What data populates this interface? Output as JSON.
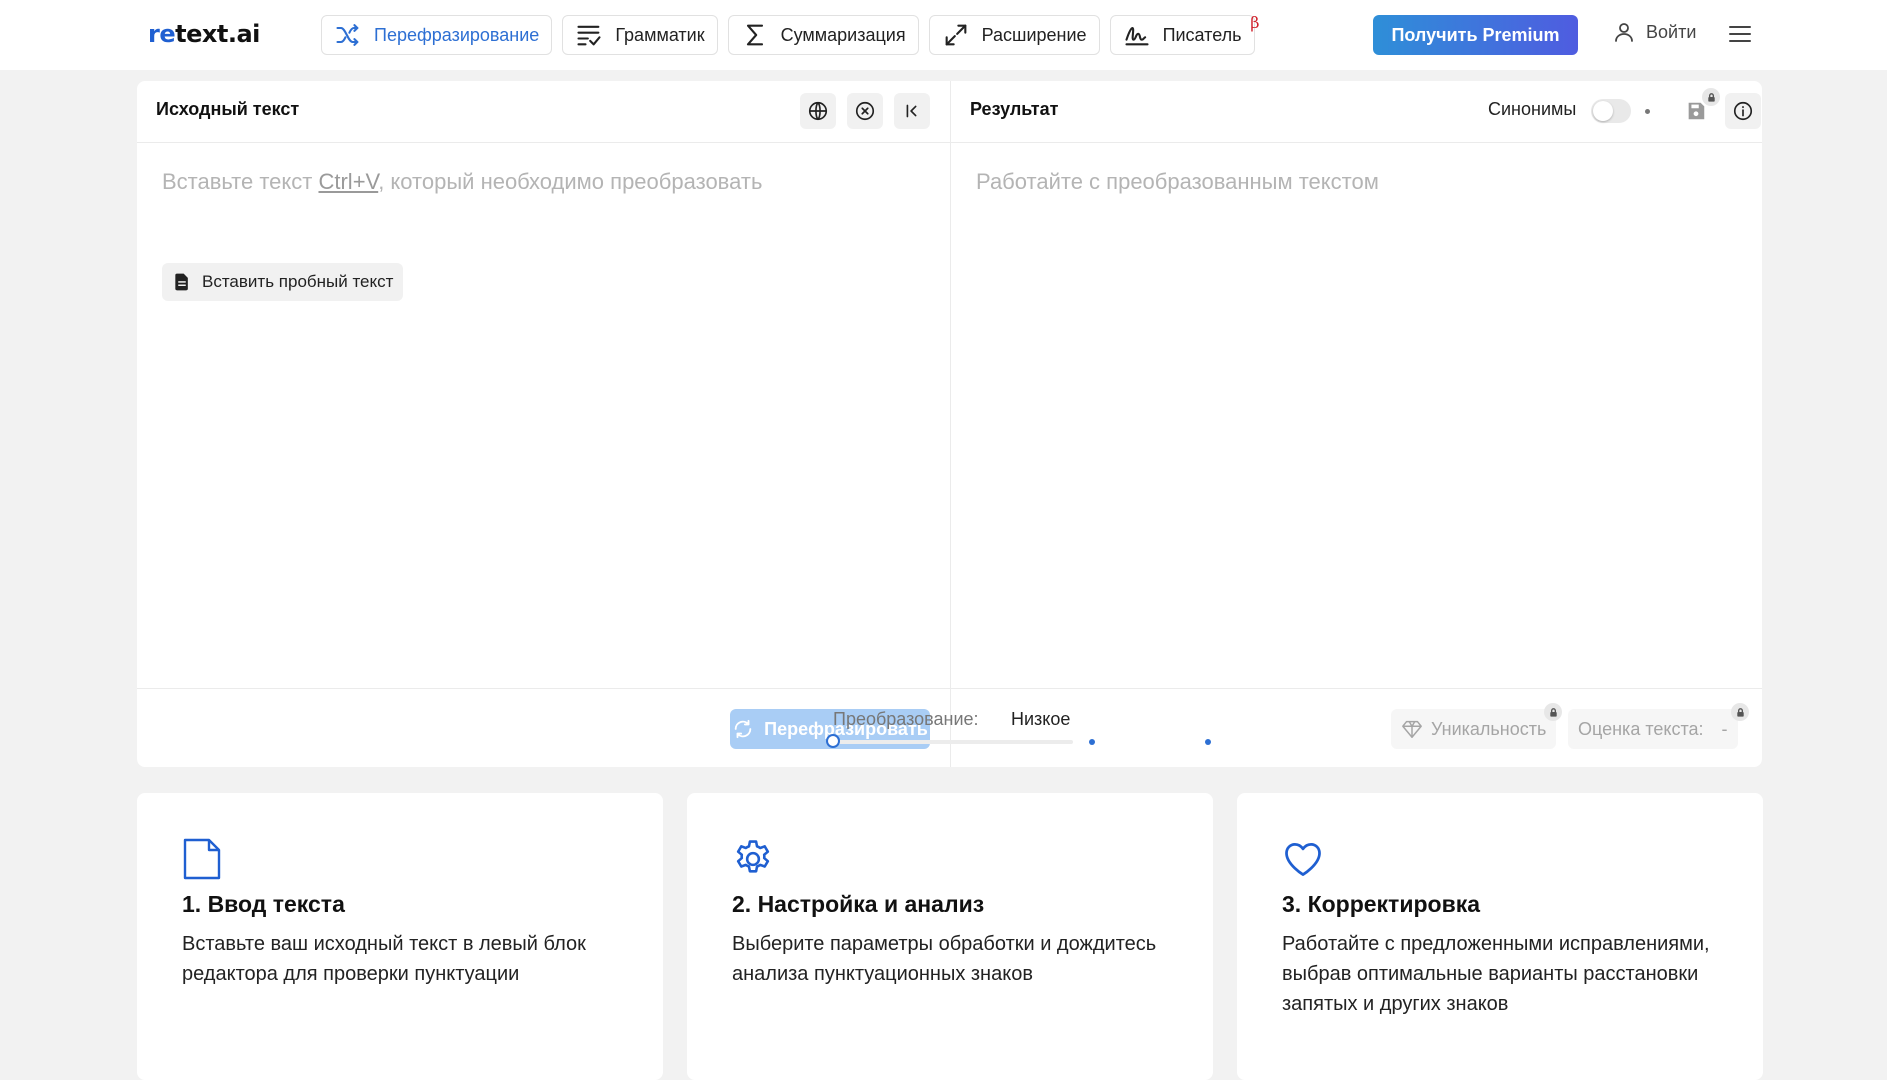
{
  "header": {
    "logo_prefix": "re",
    "logo_suffix": "text.ai",
    "nav": [
      {
        "label": "Перефразирование",
        "icon": "shuffle-icon",
        "active": true
      },
      {
        "label": "Грамматик",
        "icon": "grammar-check-icon",
        "active": false
      },
      {
        "label": "Суммаризация",
        "icon": "sigma-icon",
        "active": false
      },
      {
        "label": "Расширение",
        "icon": "expand-icon",
        "active": false
      },
      {
        "label": "Писатель",
        "icon": "signature-icon",
        "active": false,
        "badge": "β"
      }
    ],
    "premium_label": "Получить Premium",
    "login_label": "Войти"
  },
  "source": {
    "title": "Исходный текст",
    "placeholder_before": "Вставьте текст ",
    "placeholder_shortcut": "Ctrl+V",
    "placeholder_after": ", который необходимо преобразовать",
    "sample_label": "Вставить пробный текст",
    "action_label": "Перефразировать"
  },
  "result": {
    "title": "Результат",
    "synonyms_label": "Синонимы",
    "placeholder": "Работайте с преобразованным текстом",
    "transform_label": "Преобразование:",
    "transform_value": "Низкое",
    "transform_level": 0,
    "uniqueness_label": "Уникальность",
    "score_label": "Оценка текста:",
    "score_value": "-"
  },
  "steps": [
    {
      "title": "1. Ввод текста",
      "text": "Вставьте ваш исходный текст в левый блок редактора для проверки пунктуации"
    },
    {
      "title": "2. Настройка и анализ",
      "text": "Выберите параметры обработки и дождитесь анализа пунктуационных знаков"
    },
    {
      "title": "3. Корректировка",
      "text": "Работайте с предложенными исправлениями, выбрав оптимальные варианты расстановки запятых и других знаков"
    }
  ],
  "colors": {
    "accent": "#2d6fd3",
    "premium_start": "#2e8fd8",
    "premium_end": "#4f5ce0",
    "disabled_button": "#a9cdf5",
    "beta": "#d0202a"
  }
}
